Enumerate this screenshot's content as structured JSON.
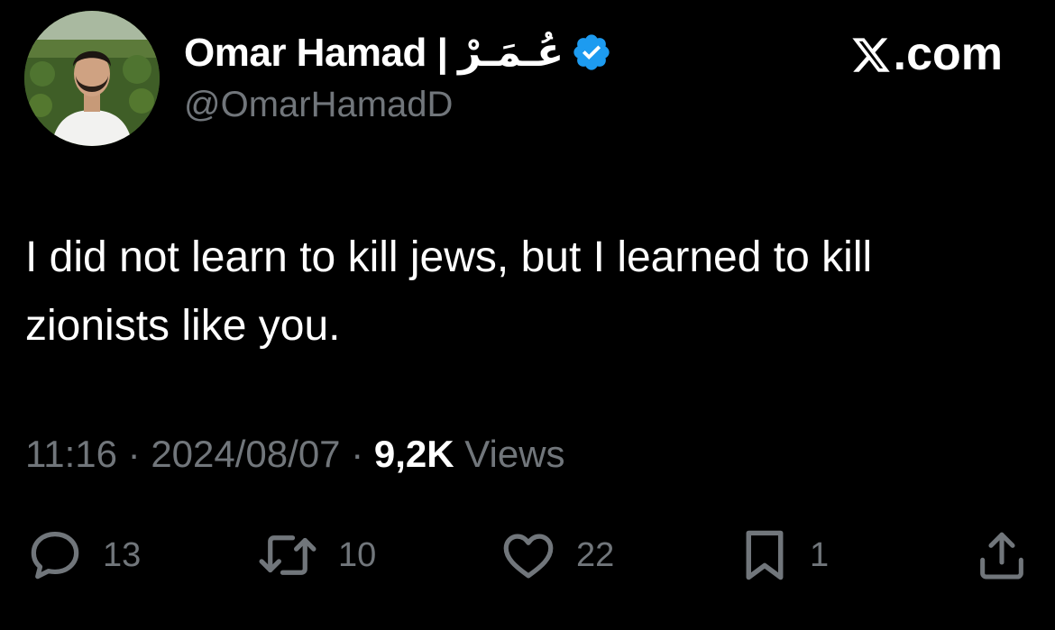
{
  "user": {
    "display_name": "Omar Hamad | عُـمَـرْ",
    "handle": "@OmarHamadD",
    "verified": true,
    "verified_color": "#1d9bf0"
  },
  "watermark": {
    "text": ".com",
    "icon": "x-logo-icon"
  },
  "tweet": {
    "text": "I did not learn to kill jews, but I learned to kill zionists like you."
  },
  "meta": {
    "time": "11:16",
    "separator1": " · ",
    "date": "2024/08/07",
    "separator2": " · ",
    "views_count": "9,2K",
    "views_label": " Views"
  },
  "actions": {
    "replies": {
      "icon": "reply-icon",
      "count": "13"
    },
    "reposts": {
      "icon": "repost-icon",
      "count": "10"
    },
    "likes": {
      "icon": "heart-icon",
      "count": "22"
    },
    "bookmarks": {
      "icon": "bookmark-icon",
      "count": "1"
    },
    "share": {
      "icon": "share-icon"
    }
  },
  "colors": {
    "background": "#000000",
    "text": "#ffffff",
    "secondary": "#71767b"
  }
}
